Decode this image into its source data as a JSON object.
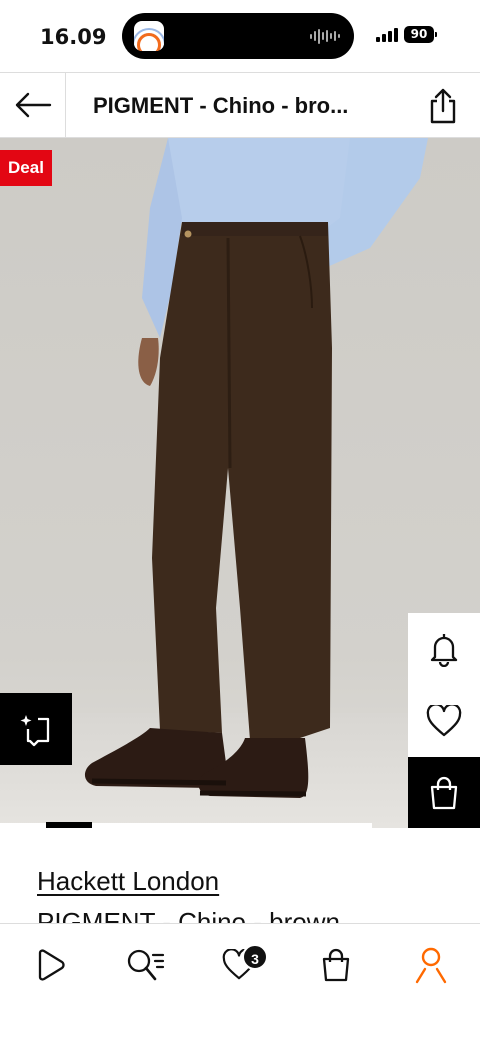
{
  "status_bar": {
    "time": "16.09",
    "battery": "90"
  },
  "header": {
    "title": "PIGMENT - Chino - bro..."
  },
  "product": {
    "deal_badge": "Deal",
    "brand": "Hackett London",
    "name": "PIGMENT - Chino - brown",
    "image_index": 2
  },
  "bottom_nav": {
    "wishlist_count": "3",
    "active_item": "profile"
  },
  "colors": {
    "deal_red": "#e30613",
    "accent_orange": "#ff6900",
    "chino_brown": "#3d2a1c",
    "shirt_blue": "#b7cdeb"
  },
  "icons": [
    "back-arrow-icon",
    "share-icon",
    "bell-icon",
    "heart-icon",
    "bag-icon",
    "similar-items-icon",
    "play-icon",
    "search-icon",
    "heart-icon",
    "bag-icon",
    "profile-icon"
  ]
}
